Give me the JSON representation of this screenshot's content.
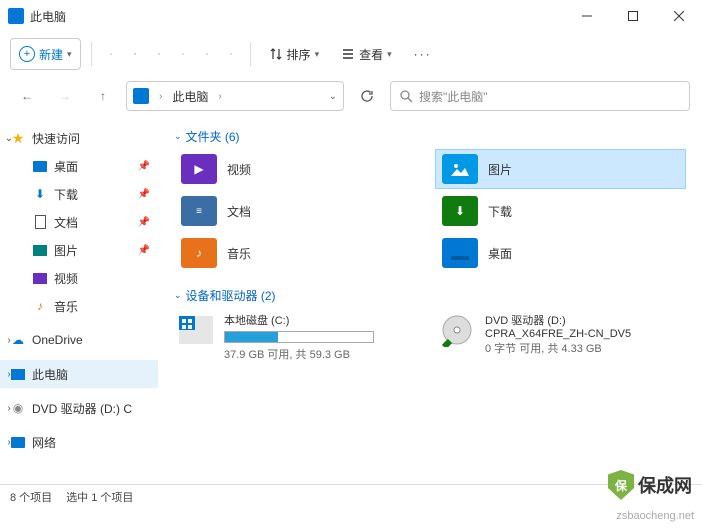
{
  "window": {
    "title": "此电脑"
  },
  "toolbar": {
    "new_label": "新建",
    "sort_label": "排序",
    "view_label": "查看"
  },
  "address": {
    "location": "此电脑"
  },
  "search": {
    "placeholder": "搜索\"此电脑\""
  },
  "sidebar": {
    "quick_access": "快速访问",
    "desktop": "桌面",
    "downloads": "下载",
    "documents": "文档",
    "pictures": "图片",
    "videos": "视频",
    "music": "音乐",
    "onedrive": "OneDrive",
    "this_pc": "此电脑",
    "dvd": "DVD 驱动器 (D:) CP",
    "network": "网络"
  },
  "sections": {
    "folders_label": "文件夹 (6)",
    "drives_label": "设备和驱动器 (2)"
  },
  "folders": {
    "videos": "视频",
    "pictures": "图片",
    "documents": "文档",
    "downloads": "下载",
    "music": "音乐",
    "desktop": "桌面"
  },
  "drives": {
    "c": {
      "name": "本地磁盘 (C:)",
      "stats": "37.9 GB 可用, 共 59.3 GB",
      "fill_pct": 36
    },
    "d": {
      "name": "DVD 驱动器 (D:)",
      "label": "CPRA_X64FRE_ZH-CN_DV5",
      "stats": "0 字节 可用, 共 4.33 GB"
    }
  },
  "status": {
    "count": "8 个项目",
    "selection": "选中 1 个项目"
  },
  "branding": {
    "text": "保成网",
    "url": "zsbaocheng.net"
  }
}
